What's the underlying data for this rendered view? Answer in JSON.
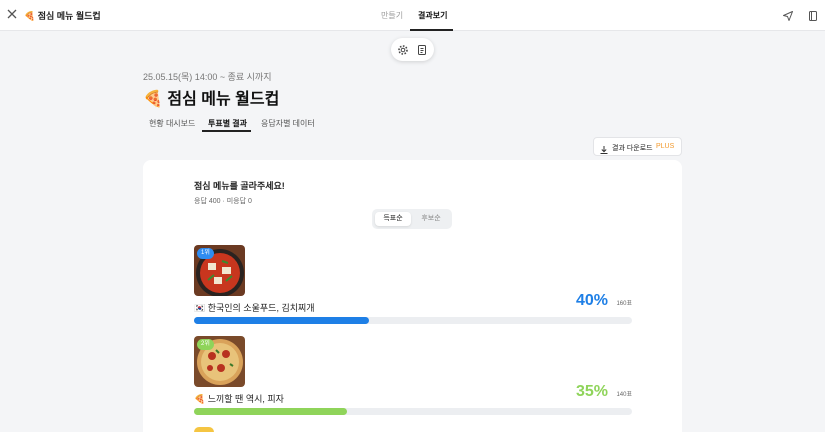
{
  "header": {
    "title": "🍕 점심 메뉴 월드컵",
    "tabs": [
      "만들기",
      "결과보기"
    ]
  },
  "survey": {
    "date_range": "25.05.15(목) 14:00 ~ 종료 시까지",
    "title": "🍕 점심 메뉴 월드컵"
  },
  "subtabs": [
    "현황 대시보드",
    "투표별 결과",
    "응답자별 데이터"
  ],
  "download": {
    "label": "결과 다운로드",
    "badge": "PLUS"
  },
  "question": {
    "title": "점심 메뉴를 골라주세요!",
    "stats": "응답 400 · 미응답 0"
  },
  "sort": {
    "options": [
      "득표순",
      "후보순"
    ],
    "selected": "득표순"
  },
  "results": [
    {
      "rank": "1위",
      "label": "🇰🇷 한국인의 소울푸드, 김치찌개",
      "percent": "40%",
      "votes": "160표",
      "fraction": 0.4,
      "color": "#1e7fe6",
      "rank_color": "#2f8cf0"
    },
    {
      "rank": "2위",
      "label": "🍕 느끼할 땐 역시, 피자",
      "percent": "35%",
      "votes": "140표",
      "fraction": 0.35,
      "color": "#8fd45a",
      "rank_color": "#8fd45a"
    }
  ],
  "partial_rank_color": "#f5c542"
}
